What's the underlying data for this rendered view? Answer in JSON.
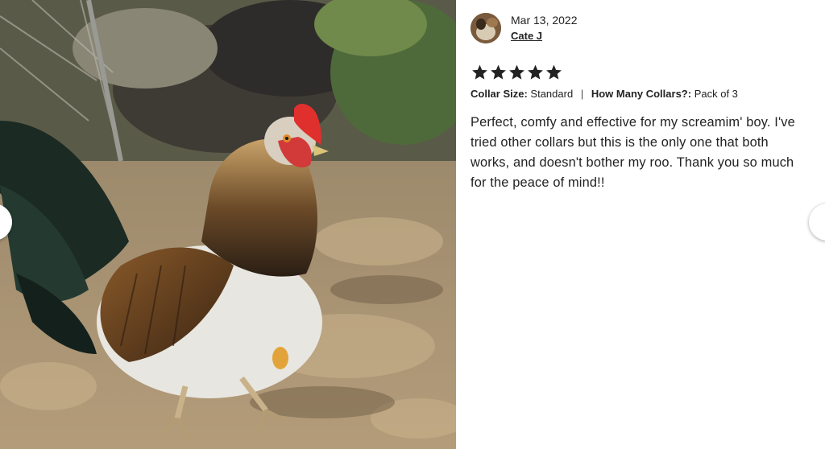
{
  "photo": {
    "alt_icon": "rooster-photo"
  },
  "review": {
    "date": "Mar 13, 2022",
    "reviewer_name": "Cate J",
    "rating": 5,
    "rating_max": 5,
    "variations": [
      {
        "label": "Collar Size:",
        "value": "Standard"
      },
      {
        "label": "How Many Collars?:",
        "value": "Pack of 3"
      }
    ],
    "separator": "|",
    "text": "Perfect, comfy and effective for my screamim' boy. I've tried other collars but this is the only one that both works, and doesn't bother my roo. Thank you so much for the peace of mind!!"
  },
  "navigation": {
    "prev_icon": "chevron-left-icon",
    "next_icon": "chevron-right-icon"
  },
  "colors": {
    "star": "#222222",
    "text": "#222222",
    "background": "#ffffff"
  }
}
